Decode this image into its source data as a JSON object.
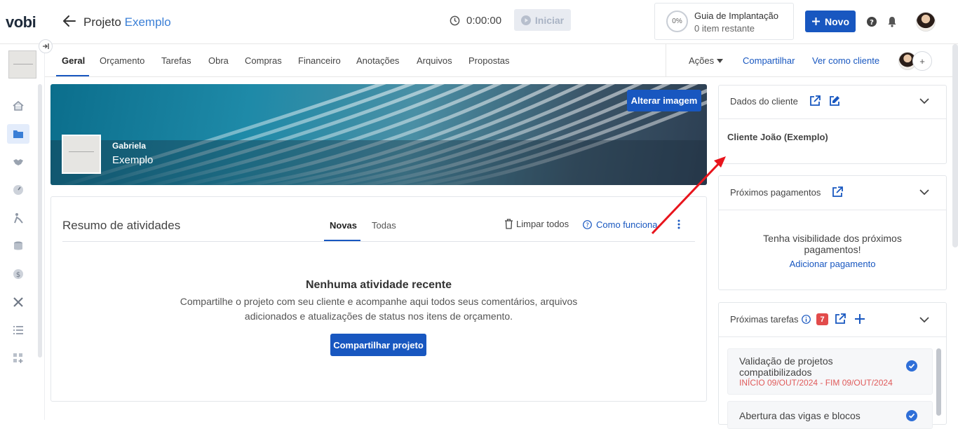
{
  "header": {
    "logo": "vobi",
    "project_prefix": "Projeto",
    "project_name": "Exemplo",
    "timer": "0:00:00",
    "start_label": "Iniciar",
    "guide_percent": "0%",
    "guide_title": "Guia de Implantação",
    "guide_sub": "0 item restante",
    "new_label": "Novo"
  },
  "tabs": {
    "items": [
      "Geral",
      "Orçamento",
      "Tarefas",
      "Obra",
      "Compras",
      "Financeiro",
      "Anotações",
      "Arquivos",
      "Propostas"
    ],
    "actions_label": "Ações",
    "share_label": "Compartilhar",
    "view_as_client_label": "Ver como cliente",
    "avatar_add": "+"
  },
  "banner": {
    "change_image_label": "Alterar imagem",
    "owner_name": "Gabriela",
    "project_name": "Exemplo"
  },
  "activity": {
    "title": "Resumo de atividades",
    "tab_new": "Novas",
    "tab_all": "Todas",
    "clear_label": "Limpar todos",
    "how_label": "Como funciona",
    "empty_title": "Nenhuma atividade recente",
    "empty_desc": "Compartilhe o projeto com seu cliente e acompanhe aqui todos seus comentários, arquivos adicionados e atualizações de status nos itens de orçamento.",
    "share_button": "Compartilhar projeto"
  },
  "client_card": {
    "title": "Dados do cliente",
    "client_name": "Cliente João (Exemplo)"
  },
  "payments_card": {
    "title": "Próximos pagamentos",
    "empty_text": "Tenha visibilidade dos próximos pagamentos!",
    "add_link": "Adicionar pagamento"
  },
  "tasks_card": {
    "title": "Próximas tarefas",
    "count": "7",
    "items": [
      {
        "title": "Validação de projetos compatibilizados",
        "dates": "INÍCIO 09/OUT/2024 - FIM 09/OUT/2024"
      },
      {
        "title": "Abertura das vigas e blocos",
        "dates": ""
      }
    ]
  },
  "colors": {
    "primary": "#1857c0",
    "accent": "#3b7fd6",
    "danger": "#e24b4b",
    "annotation_arrow": "#e8141c"
  }
}
